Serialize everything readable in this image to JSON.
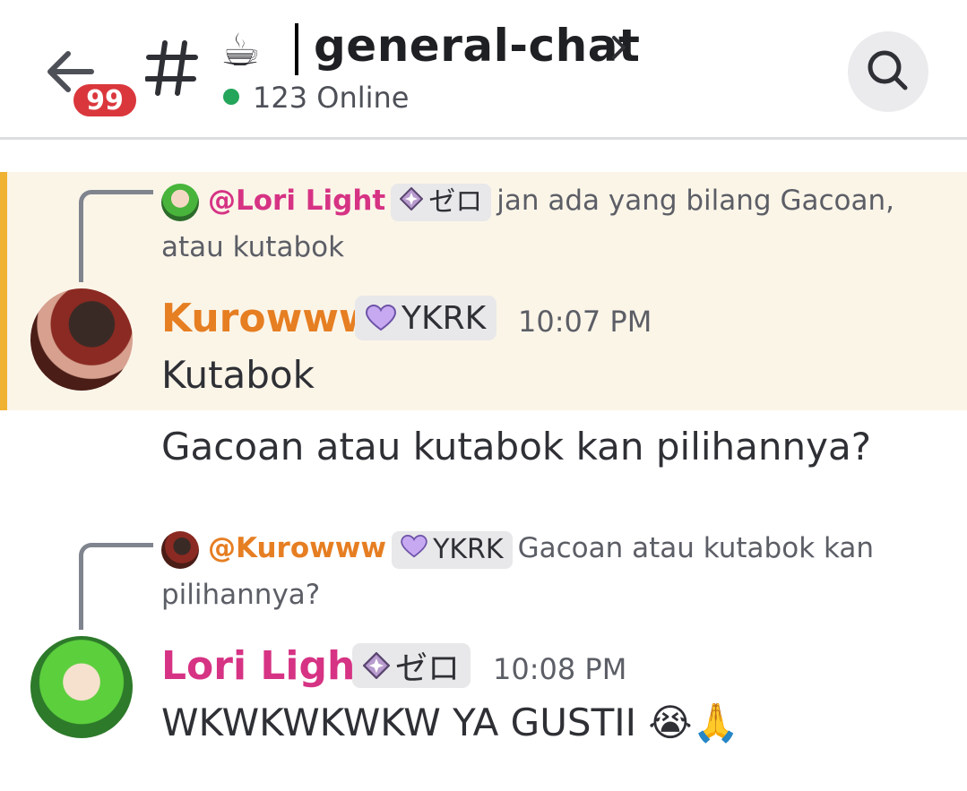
{
  "header": {
    "unread_count": "99",
    "channel_emoji": "☕",
    "channel_name": "general-chat",
    "online_text": "123 Online"
  },
  "messages": [
    {
      "reply": {
        "author": "@Lori Light",
        "tag": "ゼロ",
        "text_line1": "jan ada yang bilang Gacoan,",
        "text_line2": "atau kutabok"
      },
      "author": "Kurowww",
      "tag": "YKRK",
      "time": "10:07 PM",
      "lines": [
        "Kutabok",
        "Gacoan atau kutabok kan pilihannya?"
      ],
      "highlighted": true
    },
    {
      "reply": {
        "author": "@Kurowww",
        "tag": "YKRK",
        "text_line1": "Gacoan atau kutabok kan",
        "text_line2": "pilihannya?"
      },
      "author": "Lori Light",
      "tag": "ゼロ",
      "time": "10:08 PM",
      "lines": [
        "WKWKWKWKW YA GUSTII 😭🙏"
      ],
      "highlighted": false
    }
  ],
  "colors": {
    "kurowww": "#e67e22",
    "lori": "#d63384",
    "online_dot": "#23a55a",
    "badge": "#da373c",
    "highlight_bg": "#fbf5e8",
    "highlight_bar": "#f0b232"
  },
  "icons": {
    "back": "arrow-left-icon",
    "hash": "hash-icon",
    "chevron": "chevron-right-icon",
    "search": "search-icon",
    "tag_ykrk": "purple-heart-icon",
    "tag_zero": "sparkle-diamond-icon"
  }
}
